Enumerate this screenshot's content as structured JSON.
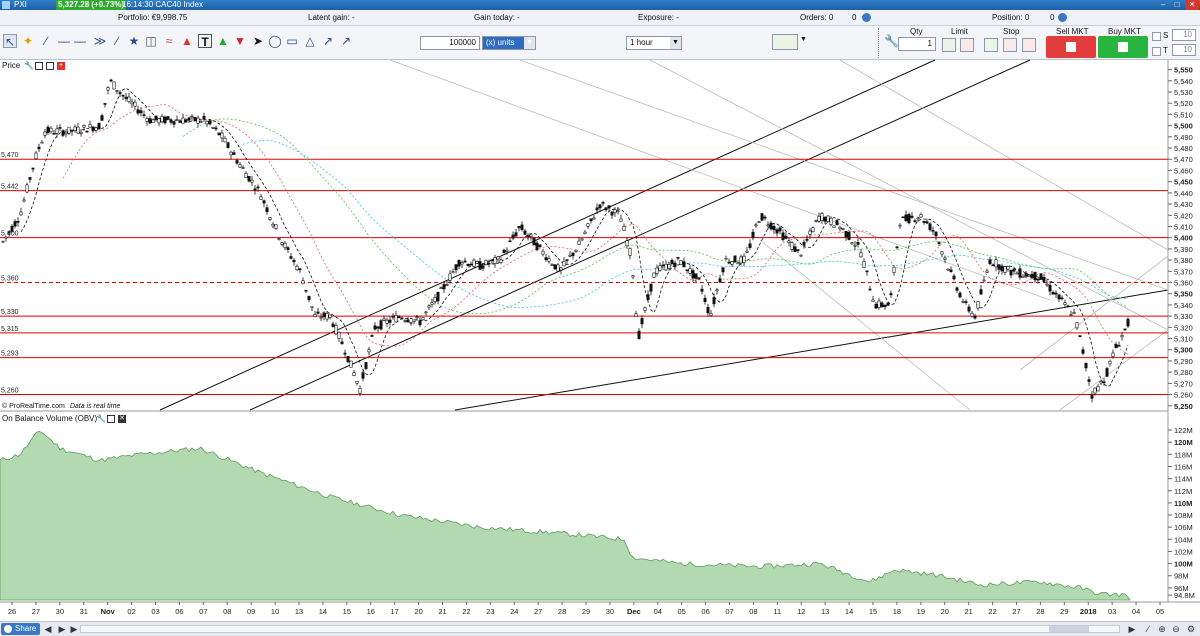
{
  "window": {
    "title": "5,327.28 (+0.73%)",
    "pxi": "PXI",
    "time_instrument": "16:14:30 CAC40 Index",
    "controls": [
      "–",
      "□",
      "✕"
    ]
  },
  "infobar": {
    "portfolio": "Portfolio: €9,998.75",
    "latent_gain": "Latent gain: -",
    "gain_today": "Gain today: -",
    "exposure": "Exposure: -",
    "orders": "Orders: 0",
    "orders_count": "0",
    "position": "Position: 0",
    "position_count": "0"
  },
  "toolbar": {
    "quantity_value": "100000",
    "units_label": "(x) units",
    "timeframe": "1 hour",
    "qty_label": "Qty",
    "qty_value": "1",
    "limit_label": "Limit",
    "stop_label": "Stop",
    "sell_label": "Sell MKT",
    "buy_label": "Buy MKT",
    "s_label": "S",
    "t_label": "T",
    "s_value": "10",
    "t_value": "10"
  },
  "price_panel": {
    "label": "Price",
    "source_note": "© ProRealTime.com",
    "source_italic": "Data is real time",
    "left_levels": [
      "5,470",
      "5,442",
      "5,400",
      "5,360",
      "5,330",
      "5,315",
      "5,293",
      "5,260"
    ],
    "y_ticks": [
      "5,550",
      "5,540",
      "5,530",
      "5,520",
      "5,510",
      "5,500",
      "5,490",
      "5,480",
      "5,470",
      "5,460",
      "5,450",
      "5,440",
      "5,430",
      "5,420",
      "5,410",
      "5,400",
      "5,390",
      "5,380",
      "5,370",
      "5,360",
      "5,350",
      "5,340",
      "5,330",
      "5,320",
      "5,310",
      "5,300",
      "5,290",
      "5,280",
      "5,270",
      "5,260",
      "5,250"
    ],
    "bold_ticks": [
      "5,550",
      "5,500",
      "5,450",
      "5,400",
      "5,350",
      "5,300",
      "5,250"
    ],
    "ylim": [
      5248,
      5555
    ]
  },
  "obv_panel": {
    "label": "On Balance Volume (OBV)",
    "y_ticks": [
      "122M",
      "120M",
      "118M",
      "116M",
      "114M",
      "112M",
      "110M",
      "108M",
      "106M",
      "104M",
      "102M",
      "100M",
      "98M",
      "96M",
      "94.8M"
    ],
    "bold_ticks": [
      "120M",
      "110M",
      "100M"
    ],
    "last_value": "94.8M",
    "ylim": [
      94,
      123
    ]
  },
  "x_axis": {
    "labels": [
      "26",
      "27",
      "30",
      "31",
      "Nov",
      "02",
      "03",
      "06",
      "07",
      "08",
      "09",
      "10",
      "13",
      "14",
      "15",
      "16",
      "17",
      "20",
      "21",
      "22",
      "23",
      "24",
      "27",
      "28",
      "29",
      "30",
      "Dec",
      "04",
      "05",
      "06",
      "07",
      "08",
      "11",
      "12",
      "13",
      "14",
      "15",
      "18",
      "19",
      "20",
      "21",
      "22",
      "27",
      "28",
      "29",
      "2018",
      "03",
      "04",
      "05"
    ],
    "bold_labels": [
      "Nov",
      "Dec",
      "2018"
    ]
  },
  "colors": {
    "candle": "#111111",
    "level_line": "#e00000",
    "obv_fill": "#b3d9b0",
    "obv_line": "#5f9a5c",
    "ma_red": "#e26060",
    "ma_green": "#4cc24c",
    "ma_cyan": "#32c7e0",
    "ma_black": "#111111"
  },
  "bottombar": {
    "share_label": "Share"
  }
}
